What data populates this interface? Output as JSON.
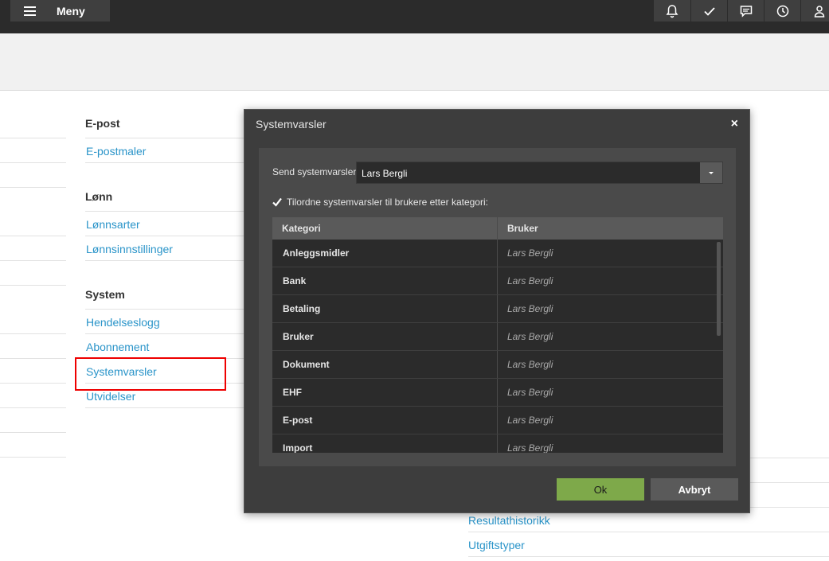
{
  "topbar": {
    "menu_label": "Meny",
    "icons": [
      "bell-icon",
      "check-icon",
      "chat-icon",
      "clock-icon",
      "user-icon"
    ]
  },
  "settings": {
    "sections": [
      {
        "title": "E-post",
        "links": [
          "E-postmaler"
        ]
      },
      {
        "title": "Lønn",
        "links": [
          "Lønnsarter",
          "Lønnsinnstillinger"
        ]
      },
      {
        "title": "System",
        "links": [
          "Hendelseslogg",
          "Abonnement",
          "Systemvarsler",
          "Utvidelser"
        ]
      }
    ],
    "right_links": [
      "Resultathistorikk",
      "Utgiftstyper"
    ]
  },
  "dialog": {
    "title": "Systemvarsler",
    "close": "×",
    "send_label": "Send systemvarsler",
    "send_value": "Lars Bergli",
    "checkbox_label": "Tilordne systemvarsler til brukere etter kategori:",
    "checkbox_checked": true,
    "columns": [
      "Kategori",
      "Bruker"
    ],
    "rows": [
      {
        "category": "Anleggsmidler",
        "user": "Lars Bergli"
      },
      {
        "category": "Bank",
        "user": "Lars Bergli"
      },
      {
        "category": "Betaling",
        "user": "Lars Bergli"
      },
      {
        "category": "Bruker",
        "user": "Lars Bergli"
      },
      {
        "category": "Dokument",
        "user": "Lars Bergli"
      },
      {
        "category": "EHF",
        "user": "Lars Bergli"
      },
      {
        "category": "E-post",
        "user": "Lars Bergli"
      },
      {
        "category": "Import",
        "user": "Lars Bergli"
      }
    ],
    "ok_label": "Ok",
    "cancel_label": "Avbryt"
  },
  "colors": {
    "accent_link": "#2a94c9",
    "ok_button": "#7ea94a",
    "highlight_box": "#ee0000"
  }
}
